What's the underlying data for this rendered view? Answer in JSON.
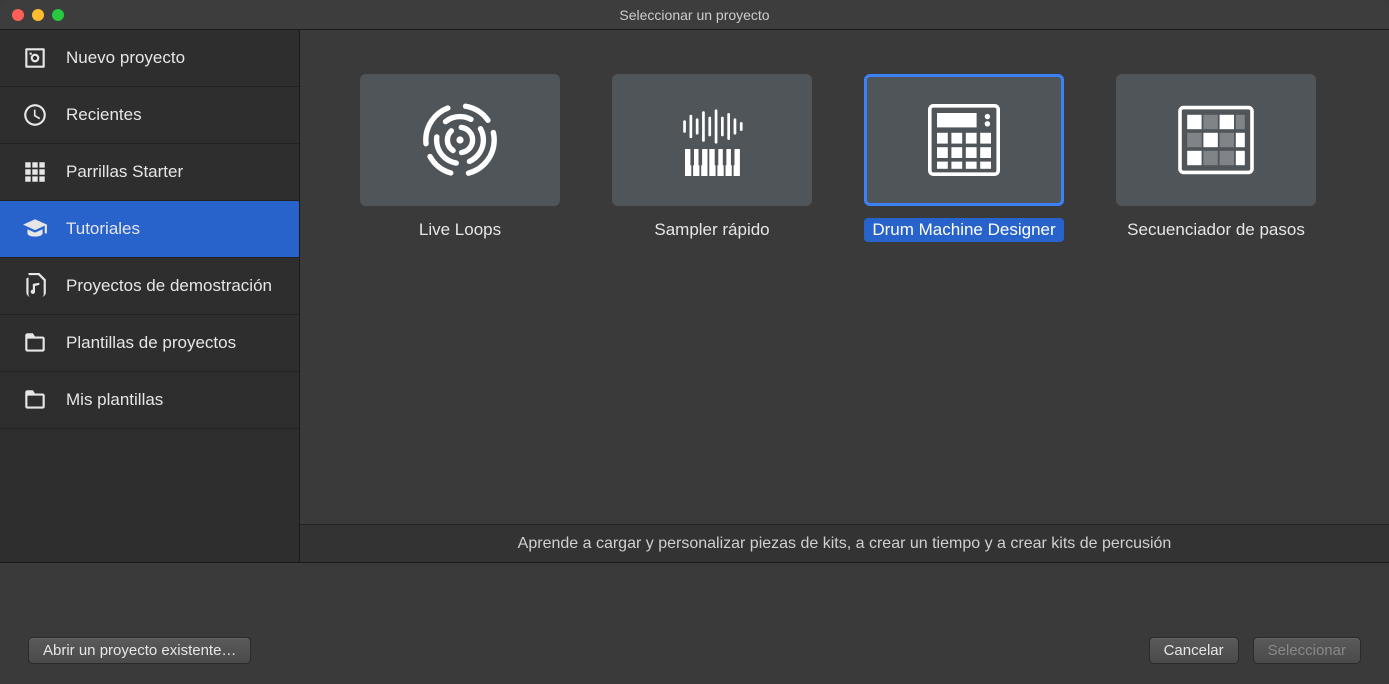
{
  "window": {
    "title": "Seleccionar un proyecto"
  },
  "sidebar": {
    "items": [
      {
        "id": "new-project",
        "label": "Nuevo proyecto"
      },
      {
        "id": "recents",
        "label": "Recientes"
      },
      {
        "id": "starter-grids",
        "label": "Parrillas Starter"
      },
      {
        "id": "tutorials",
        "label": "Tutoriales"
      },
      {
        "id": "demo-projects",
        "label": "Proyectos de demostración"
      },
      {
        "id": "project-templates",
        "label": "Plantillas de proyectos"
      },
      {
        "id": "my-templates",
        "label": "Mis plantillas"
      }
    ],
    "selected": "tutorials"
  },
  "templates": {
    "items": [
      {
        "id": "live-loops",
        "label": "Live Loops"
      },
      {
        "id": "quick-sampler",
        "label": "Sampler rápido"
      },
      {
        "id": "drum-machine-designer",
        "label": "Drum Machine Designer"
      },
      {
        "id": "step-sequencer",
        "label": "Secuenciador de pasos"
      }
    ],
    "selected": "drum-machine-designer",
    "description": "Aprende a cargar y personalizar piezas de kits, a crear un tiempo y a crear kits de percusión"
  },
  "footer": {
    "open_existing": "Abrir un proyecto existente…",
    "cancel": "Cancelar",
    "select": "Seleccionar"
  }
}
